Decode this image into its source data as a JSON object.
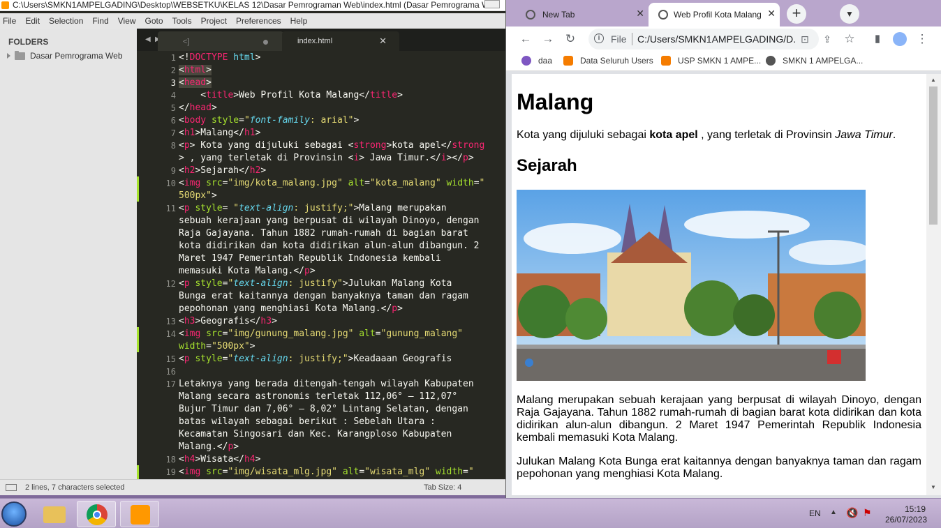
{
  "sublime": {
    "title": "C:\\Users\\SMKN1AMPELGADING\\Desktop\\WEBSETKU\\KELAS 12\\Dasar Pemrograman Web\\index.html (Dasar Pemrograma W...",
    "menu": [
      "File",
      "Edit",
      "Selection",
      "Find",
      "View",
      "Goto",
      "Tools",
      "Project",
      "Preferences",
      "Help"
    ],
    "sidebar_header": "FOLDERS",
    "folder_name": "Dasar Pemrograma Web",
    "tabs": [
      {
        "label": "<]",
        "modified": true
      },
      {
        "label": "index.html",
        "active": true
      }
    ],
    "line_numbers": [
      "1",
      "2",
      "3",
      "4",
      "5",
      "6",
      "7",
      "8",
      "",
      "9",
      "10",
      "",
      "11",
      "",
      "",
      "",
      "",
      "",
      "12",
      "",
      "",
      "13",
      "14",
      "",
      "15",
      "16",
      "17",
      "",
      "",
      "",
      "",
      "",
      "18",
      "19"
    ],
    "status_message": "2 lines, 7 characters selected",
    "tab_size": "Tab Size: 4"
  },
  "chrome": {
    "tabs": [
      {
        "label": "New Tab"
      },
      {
        "label": "Web Profil Kota Malang",
        "active": true
      }
    ],
    "omnibox_scheme": "File",
    "omnibox_url": "C:/Users/SMKN1AMPELGADING/D...",
    "bookmarks": [
      {
        "label": "daa",
        "color": "#7e57c2"
      },
      {
        "label": "Data Seluruh Users",
        "color": "#f57c00"
      },
      {
        "label": "USP SMKN 1 AMPE...",
        "color": "#f57c00"
      },
      {
        "label": "SMKN 1 AMPELGA...",
        "color": "#555555"
      }
    ]
  },
  "webpage": {
    "h1": "Malang",
    "intro_before": "Kota yang dijuluki sebagai ",
    "intro_strong": "kota apel",
    "intro_mid": " , yang terletak di Provinsin ",
    "intro_italic": "Jawa Timur",
    "intro_end": ".",
    "h2": "Sejarah",
    "para1": "Malang merupakan sebuah kerajaan yang berpusat di wilayah Dinoyo, dengan Raja Gajayana. Tahun 1882 rumah-rumah di bagian barat kota didirikan dan kota didirikan alun-alun dibangun. 2 Maret 1947 Pemerintah Republik Indonesia kembali memasuki Kota Malang.",
    "para2": "Julukan Malang Kota Bunga erat kaitannya dengan banyaknya taman dan ragam pepohonan yang menghiasi Kota Malang."
  },
  "taskbar": {
    "language": "EN",
    "time": "15:19",
    "date": "26/07/2023"
  },
  "colors": {
    "editor_bg": "#272822",
    "tag": "#f92672",
    "attr": "#a6e22e",
    "string": "#e6db74",
    "css_prop": "#66d9ef"
  }
}
